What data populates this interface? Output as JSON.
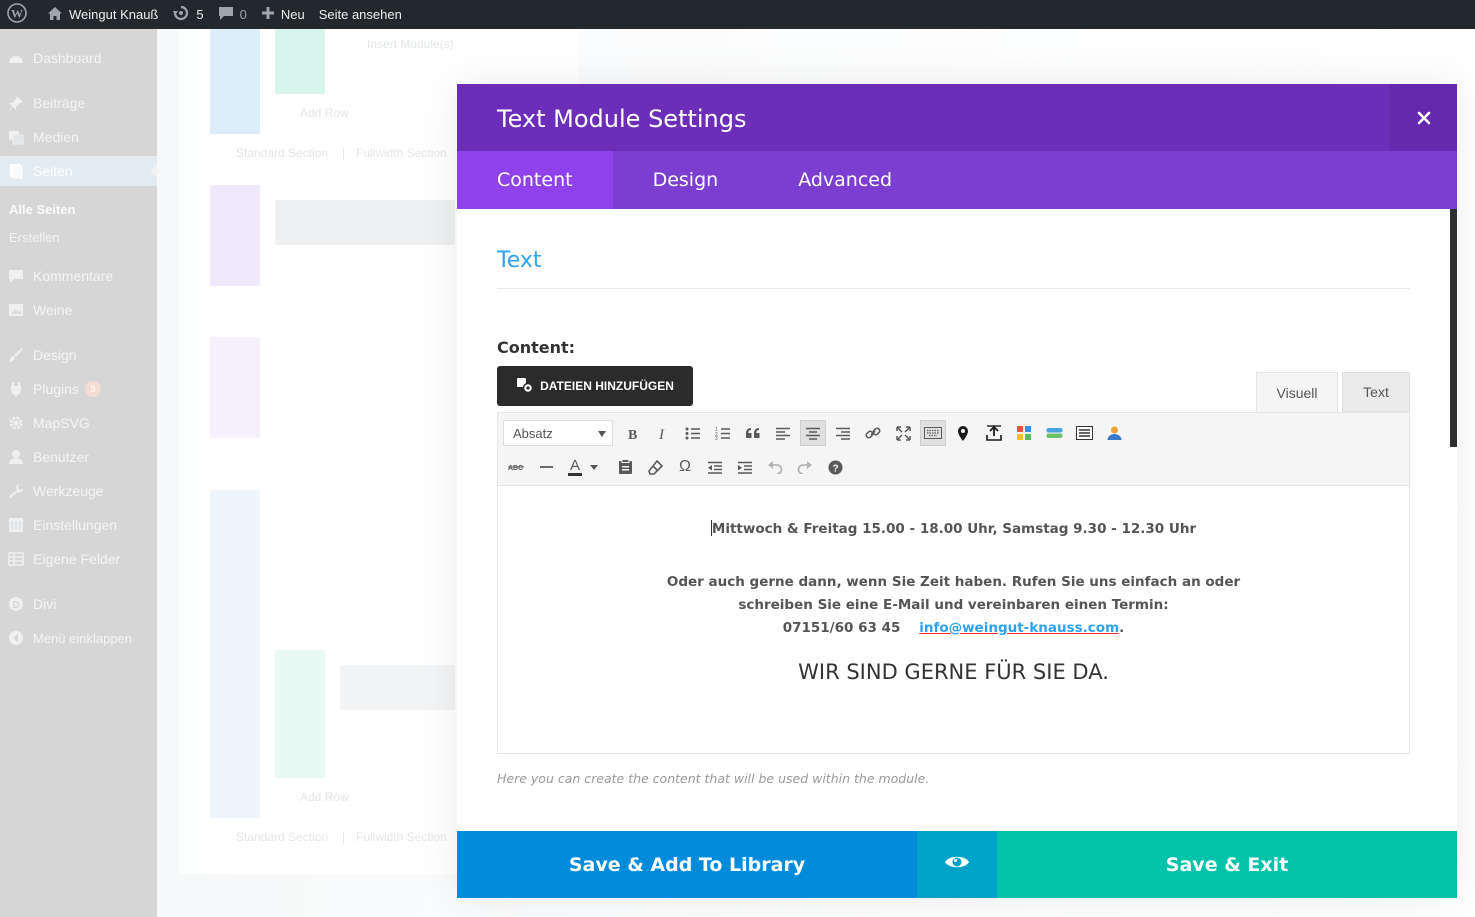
{
  "adminbar": {
    "site_name": "Weingut Knauß",
    "updates_count": "5",
    "comments_count": "0",
    "new_label": "Neu",
    "view_site_label": "Seite ansehen",
    "icons": [
      "wordpress-logo-icon",
      "home-icon",
      "updates-icon",
      "comment-icon",
      "plus-icon"
    ]
  },
  "sidebar": {
    "items": [
      {
        "label": "Dashboard",
        "icon": "dashboard-icon"
      },
      {
        "label": "Beiträge",
        "icon": "pin-icon"
      },
      {
        "label": "Medien",
        "icon": "media-icon"
      },
      {
        "label": "Seiten",
        "icon": "pages-icon"
      },
      {
        "label": "Kommentare",
        "icon": "comment-icon"
      },
      {
        "label": "Weine",
        "icon": "image-icon"
      },
      {
        "label": "Design",
        "icon": "brush-icon"
      },
      {
        "label": "Plugins",
        "icon": "plugin-icon",
        "badge": "3"
      },
      {
        "label": "MapSVG",
        "icon": "gear-icon"
      },
      {
        "label": "Benutzer",
        "icon": "user-icon"
      },
      {
        "label": "Werkzeuge",
        "icon": "wrench-icon"
      },
      {
        "label": "Einstellungen",
        "icon": "settings-icon"
      },
      {
        "label": "Eigene Felder",
        "icon": "table-icon"
      },
      {
        "label": "Divi",
        "icon": "divi-icon"
      },
      {
        "label": "Menü einklappen",
        "icon": "collapse-icon"
      }
    ],
    "submenu": [
      "Alle Seiten",
      "Erstellen"
    ]
  },
  "builder_bg": {
    "insert_modules": "Insert Module(s)",
    "add_row": "Add Row",
    "standard_section": "Standard Section",
    "fullwidth_section": "Fullwidth Section",
    "separator": "|"
  },
  "modal": {
    "title": "Text Module Settings",
    "close_icon": "close-icon",
    "tabs": [
      "Content",
      "Design",
      "Advanced"
    ],
    "section_heading": "Text",
    "content_label": "Content:",
    "add_media_label": "DATEIEN HINZUFÜGEN",
    "editor_tabs": [
      "Visuell",
      "Text"
    ],
    "format_select_value": "Absatz",
    "toolbar_row1_icons": [
      "bold-icon",
      "italic-icon",
      "bullet-list-icon",
      "numbered-list-icon",
      "blockquote-icon",
      "align-left-icon",
      "align-center-icon",
      "align-right-icon",
      "link-icon",
      "fullscreen-icon",
      "keyboard-icon",
      "map-pin-icon",
      "upload-icon",
      "grid-icon",
      "button-icon",
      "list-icon",
      "user-icon"
    ],
    "toolbar_row2_icons": [
      "strikethrough-icon",
      "horizontal-line-icon",
      "text-color-icon",
      "paste-icon",
      "eraser-icon",
      "omega-icon",
      "outdent-icon",
      "indent-icon",
      "undo-icon",
      "redo-icon",
      "help-icon"
    ],
    "text_color_glyph": "A",
    "omega_glyph": "Ω",
    "editor": {
      "hours": "Mittwoch & Freitag 15.00 - 18.00 Uhr, Samstag 9.30 - 12.30 Uhr",
      "contact_line1": "Oder auch gerne dann, wenn Sie Zeit haben. Rufen Sie uns einfach an oder",
      "contact_line2": "schreiben Sie eine E-Mail und vereinbaren einen Termin:",
      "phone": "07151/60 63 45",
      "email": "info@weingut-knauss.com",
      "email_suffix": ".",
      "slogan": "WIR SIND GERNE FÜR SIE DA."
    },
    "helper_text": "Here you can create the content that will be used within the module.",
    "footer": {
      "save_library": "Save & Add To Library",
      "preview_icon": "eye-icon",
      "save_exit": "Save & Exit"
    }
  },
  "colors": {
    "header_purple": "#6c2eb9",
    "tabs_purple": "#7b3ed1",
    "active_tab": "#8f42ec",
    "blue_button": "#008bdb",
    "teal_button": "#00c3aa",
    "link_blue": "#2ea3f2",
    "adminbar": "#23282d"
  }
}
